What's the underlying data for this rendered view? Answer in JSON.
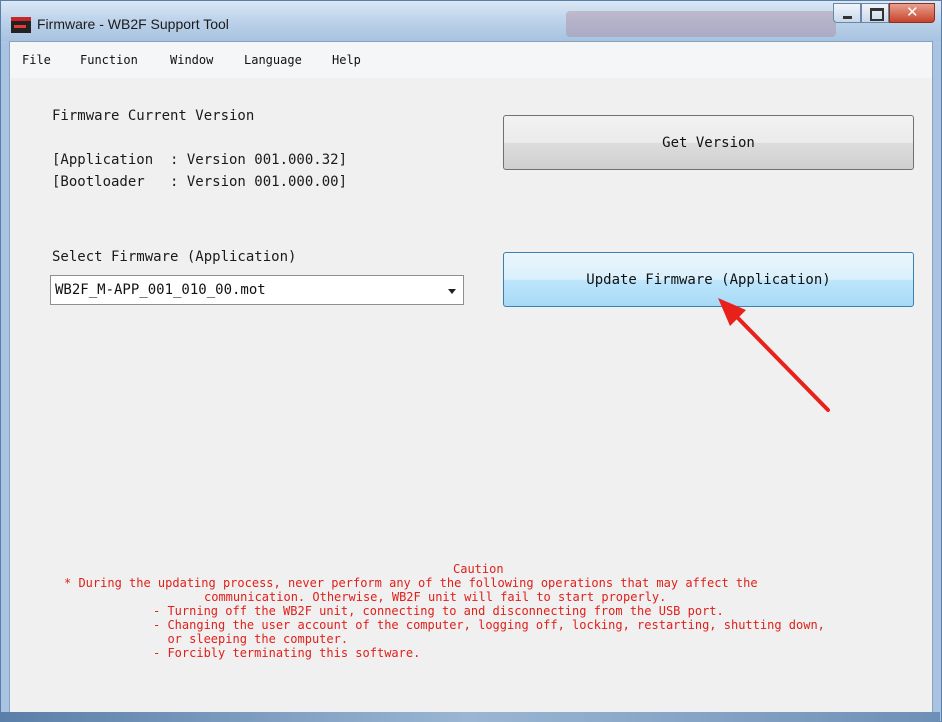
{
  "window": {
    "title": "Firmware - WB2F Support Tool"
  },
  "menu": [
    "File",
    "Function",
    "Window",
    "Language",
    "Help"
  ],
  "version_panel": {
    "heading": "Firmware Current Version",
    "application_line": "[Application  : Version 001.000.32]",
    "bootloader_line": "[Bootloader   : Version 001.000.00]"
  },
  "buttons": {
    "get_version": "Get Version",
    "update_firmware": "Update Firmware (Application)"
  },
  "select_firmware": {
    "label": "Select Firmware (Application)",
    "selected": "WB2F_M-APP_001_010_00.mot"
  },
  "caution": {
    "title": "Caution",
    "lines": [
      "* During the updating process, never perform any of the following operations that may affect the",
      "communication. Otherwise, WB2F unit will fail to start properly.",
      "- Turning off the WB2F unit, connecting to and disconnecting from the USB port.",
      "- Changing the user account of the computer, logging off, locking, restarting, shutting down,",
      "  or sleeping the computer.",
      "- Forcibly terminating this software."
    ]
  },
  "colors": {
    "caution_text": "#e0201b",
    "arrow": "#e8211b",
    "hot_button": "#bee6fd"
  },
  "icons": {
    "app_icon": "app-icon",
    "minimize": "minimize-icon",
    "maximize": "maximize-icon",
    "close": "close-icon",
    "dropdown": "chevron-down-icon",
    "annotation": "red-arrow-annotation"
  }
}
